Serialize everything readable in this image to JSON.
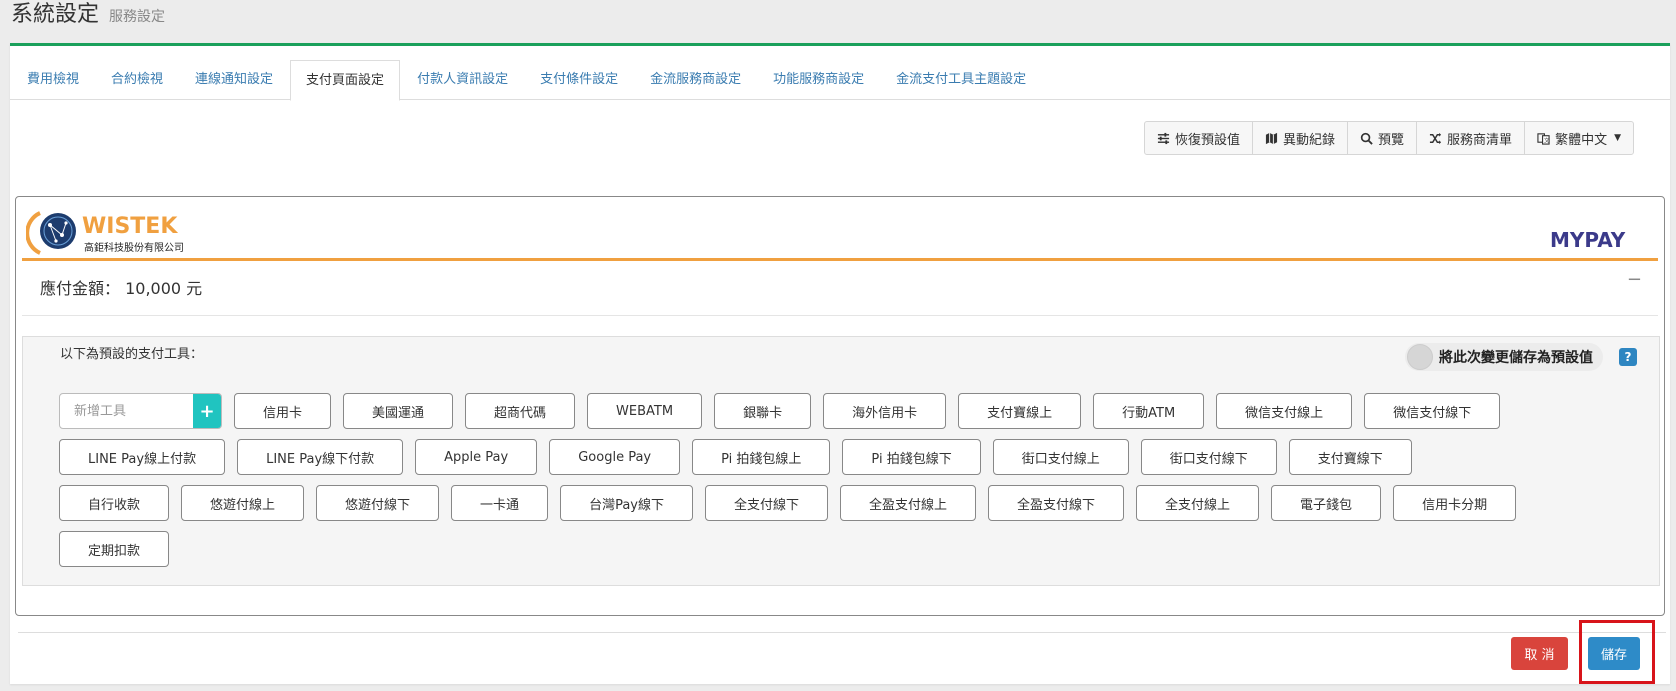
{
  "header": {
    "title": "系統設定",
    "subtitle": "服務設定"
  },
  "tabs": [
    {
      "label": "費用檢視",
      "active": false
    },
    {
      "label": "合約檢視",
      "active": false
    },
    {
      "label": "連線通知設定",
      "active": false
    },
    {
      "label": "支付頁面設定",
      "active": true
    },
    {
      "label": "付款人資訊設定",
      "active": false
    },
    {
      "label": "支付條件設定",
      "active": false
    },
    {
      "label": "金流服務商設定",
      "active": false
    },
    {
      "label": "功能服務商設定",
      "active": false
    },
    {
      "label": "金流支付工具主題設定",
      "active": false
    }
  ],
  "toolbar": {
    "restore": "恢復預設值",
    "history": "異動紀錄",
    "preview": "預覽",
    "providers": "服務商清單",
    "language": "繁體中文"
  },
  "preview": {
    "brand": {
      "name": "WISTEK",
      "company": "高鉅科技股份有限公司",
      "partner_logo": "MYPAY"
    },
    "amount_label": "應付金額：",
    "amount_value": "10,000 元",
    "collapse": "−"
  },
  "tools": {
    "label": "以下為預設的支付工具：",
    "toggle_label": "將此次變更儲存為預設值",
    "help": "?",
    "add_placeholder": "新增工具",
    "add_icon": "+",
    "rows": [
      [
        "信用卡",
        "美國運通",
        "超商代碼",
        "WEBATM",
        "銀聯卡",
        "海外信用卡",
        "支付寶線上",
        "行動ATM",
        "微信支付線上",
        "微信支付線下"
      ],
      [
        "LINE Pay線上付款",
        "LINE Pay線下付款",
        "Apple Pay",
        "Google Pay",
        "Pi 拍錢包線上",
        "Pi 拍錢包線下",
        "街口支付線上",
        "街口支付線下",
        "支付寶線下"
      ],
      [
        "自行收款",
        "悠遊付線上",
        "悠遊付線下",
        "一卡通",
        "台灣Pay線下",
        "全支付線下",
        "全盈支付線上",
        "全盈支付線下",
        "全支付線上",
        "電子錢包",
        "信用卡分期"
      ],
      [
        "定期扣款"
      ]
    ]
  },
  "actions": {
    "cancel": "取 消",
    "save": "儲存"
  },
  "colors": {
    "accent": "#1aa05b",
    "brand_orange": "#f0a040",
    "cancel": "#d9443c",
    "save": "#2e8bc8",
    "highlight": "#d8141a"
  }
}
